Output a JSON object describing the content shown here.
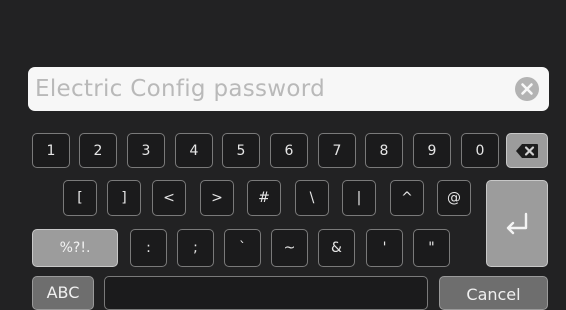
{
  "input": {
    "placeholder": "Electric Config password"
  },
  "rows": {
    "digits": [
      "1",
      "2",
      "3",
      "4",
      "5",
      "6",
      "7",
      "8",
      "9",
      "0"
    ],
    "symbols1": [
      "[",
      "]",
      "<",
      ">",
      "#",
      "\\",
      "|",
      "^",
      "@"
    ],
    "symbols2": [
      ":",
      ";",
      "`",
      "~",
      "&",
      "'",
      "\""
    ]
  },
  "keys": {
    "mode": "%?!.",
    "abc": "ABC",
    "cancel": "Cancel"
  },
  "icons": {
    "backspace": "backspace-icon",
    "enter": "enter-icon",
    "clear": "clear-icon"
  },
  "colors": {
    "background": "#222223",
    "key": "#1b1b1c",
    "key_border": "#7a7a7a",
    "special_key": "#9c9c9c",
    "input": "#f7f7f7"
  }
}
